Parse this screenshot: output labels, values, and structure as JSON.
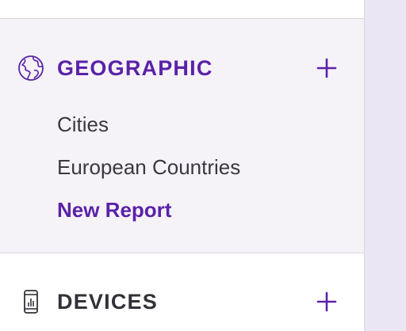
{
  "sidebar": {
    "sections": [
      {
        "id": "geographic",
        "title": "GEOGRAPHIC",
        "icon": "globe-icon",
        "add_icon": "plus-icon",
        "items": [
          {
            "label": "Cities"
          },
          {
            "label": "European Countries"
          }
        ],
        "new_report_label": "New Report"
      },
      {
        "id": "devices",
        "title": "DEVICES",
        "icon": "mobile-device-icon",
        "add_icon": "plus-icon"
      }
    ]
  },
  "colors": {
    "accent": "#5b22a8",
    "text": "#3a3840",
    "active_section_bg": "#f5f3f8",
    "page_bg": "#ebe6f3"
  }
}
